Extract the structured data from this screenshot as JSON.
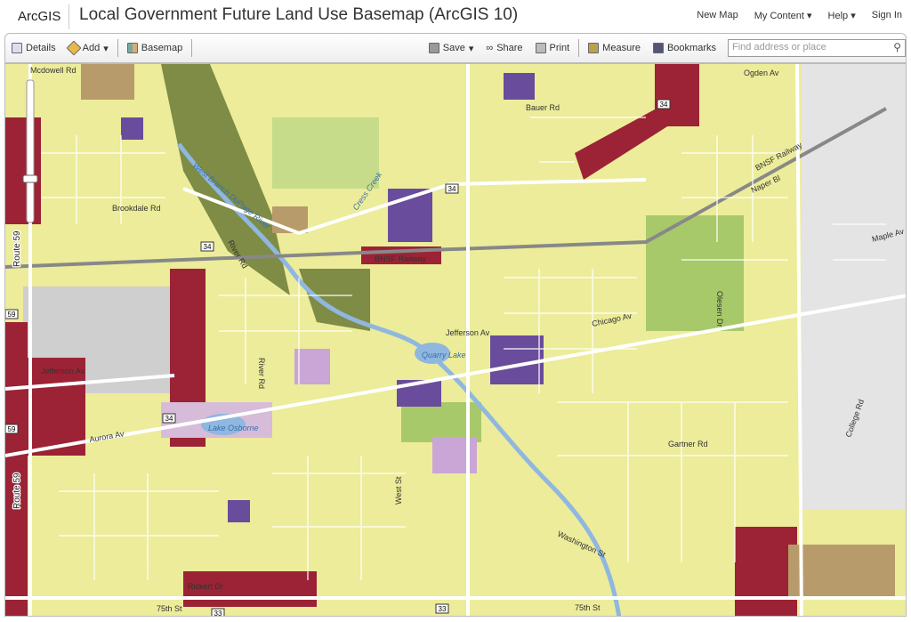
{
  "header": {
    "logo": "ArcGIS",
    "title": "Local Government Future Land Use Basemap (ArcGIS 10)",
    "nav": [
      "New Map",
      "My Content ▾",
      "Help ▾",
      "Sign In"
    ]
  },
  "toolbar": {
    "details": "Details",
    "add": "Add",
    "basemap": "Basemap",
    "save": "Save",
    "share": "Share",
    "print": "Print",
    "measure": "Measure",
    "bookmarks": "Bookmarks",
    "search_placeholder": "Find address or place"
  },
  "map": {
    "labels": {
      "mcdowell": "Mcdowell Rd",
      "ogden": "Ogden Av",
      "bauer": "Bauer Rd",
      "brookdale": "Brookdale Rd",
      "river_branch": "West Branch DuPage River",
      "cress": "Cress Creek",
      "bnsf": "BNSF Railway",
      "bnsf2": "BNSF Railway",
      "river_rd": "River Rd",
      "river_rd2": "River Rd",
      "naper": "Naper Bl",
      "maple": "Maple Av",
      "route59": "Route 59",
      "route59b": "Route 59",
      "jefferson": "Jefferson Av",
      "jefferson2": "Jefferson Av",
      "chicago": "Chicago Av",
      "quarry": "Quarry Lake",
      "olesen": "Olesen Dr",
      "aurora": "Aurora Av",
      "osborne": "Lake Osborne",
      "west": "West St",
      "gartner": "Gartner Rd",
      "washington": "Washington St",
      "rickert": "Rickert Dr",
      "75th": "75th St",
      "75th2": "75th St",
      "college": "College Rd"
    },
    "shields": [
      "34",
      "34",
      "34",
      "34",
      "59",
      "59",
      "33",
      "33"
    ],
    "colors": {
      "residential": "#ecec9a",
      "commercial": "#9b2335",
      "institutional": "#6a4c9c",
      "park": "#a8c96a",
      "open": "#7e8c45",
      "industrial": "#cfcfcf",
      "office": "#b89b6a",
      "mixed": "#c9a6d6",
      "water": "#8fb7e0"
    }
  }
}
